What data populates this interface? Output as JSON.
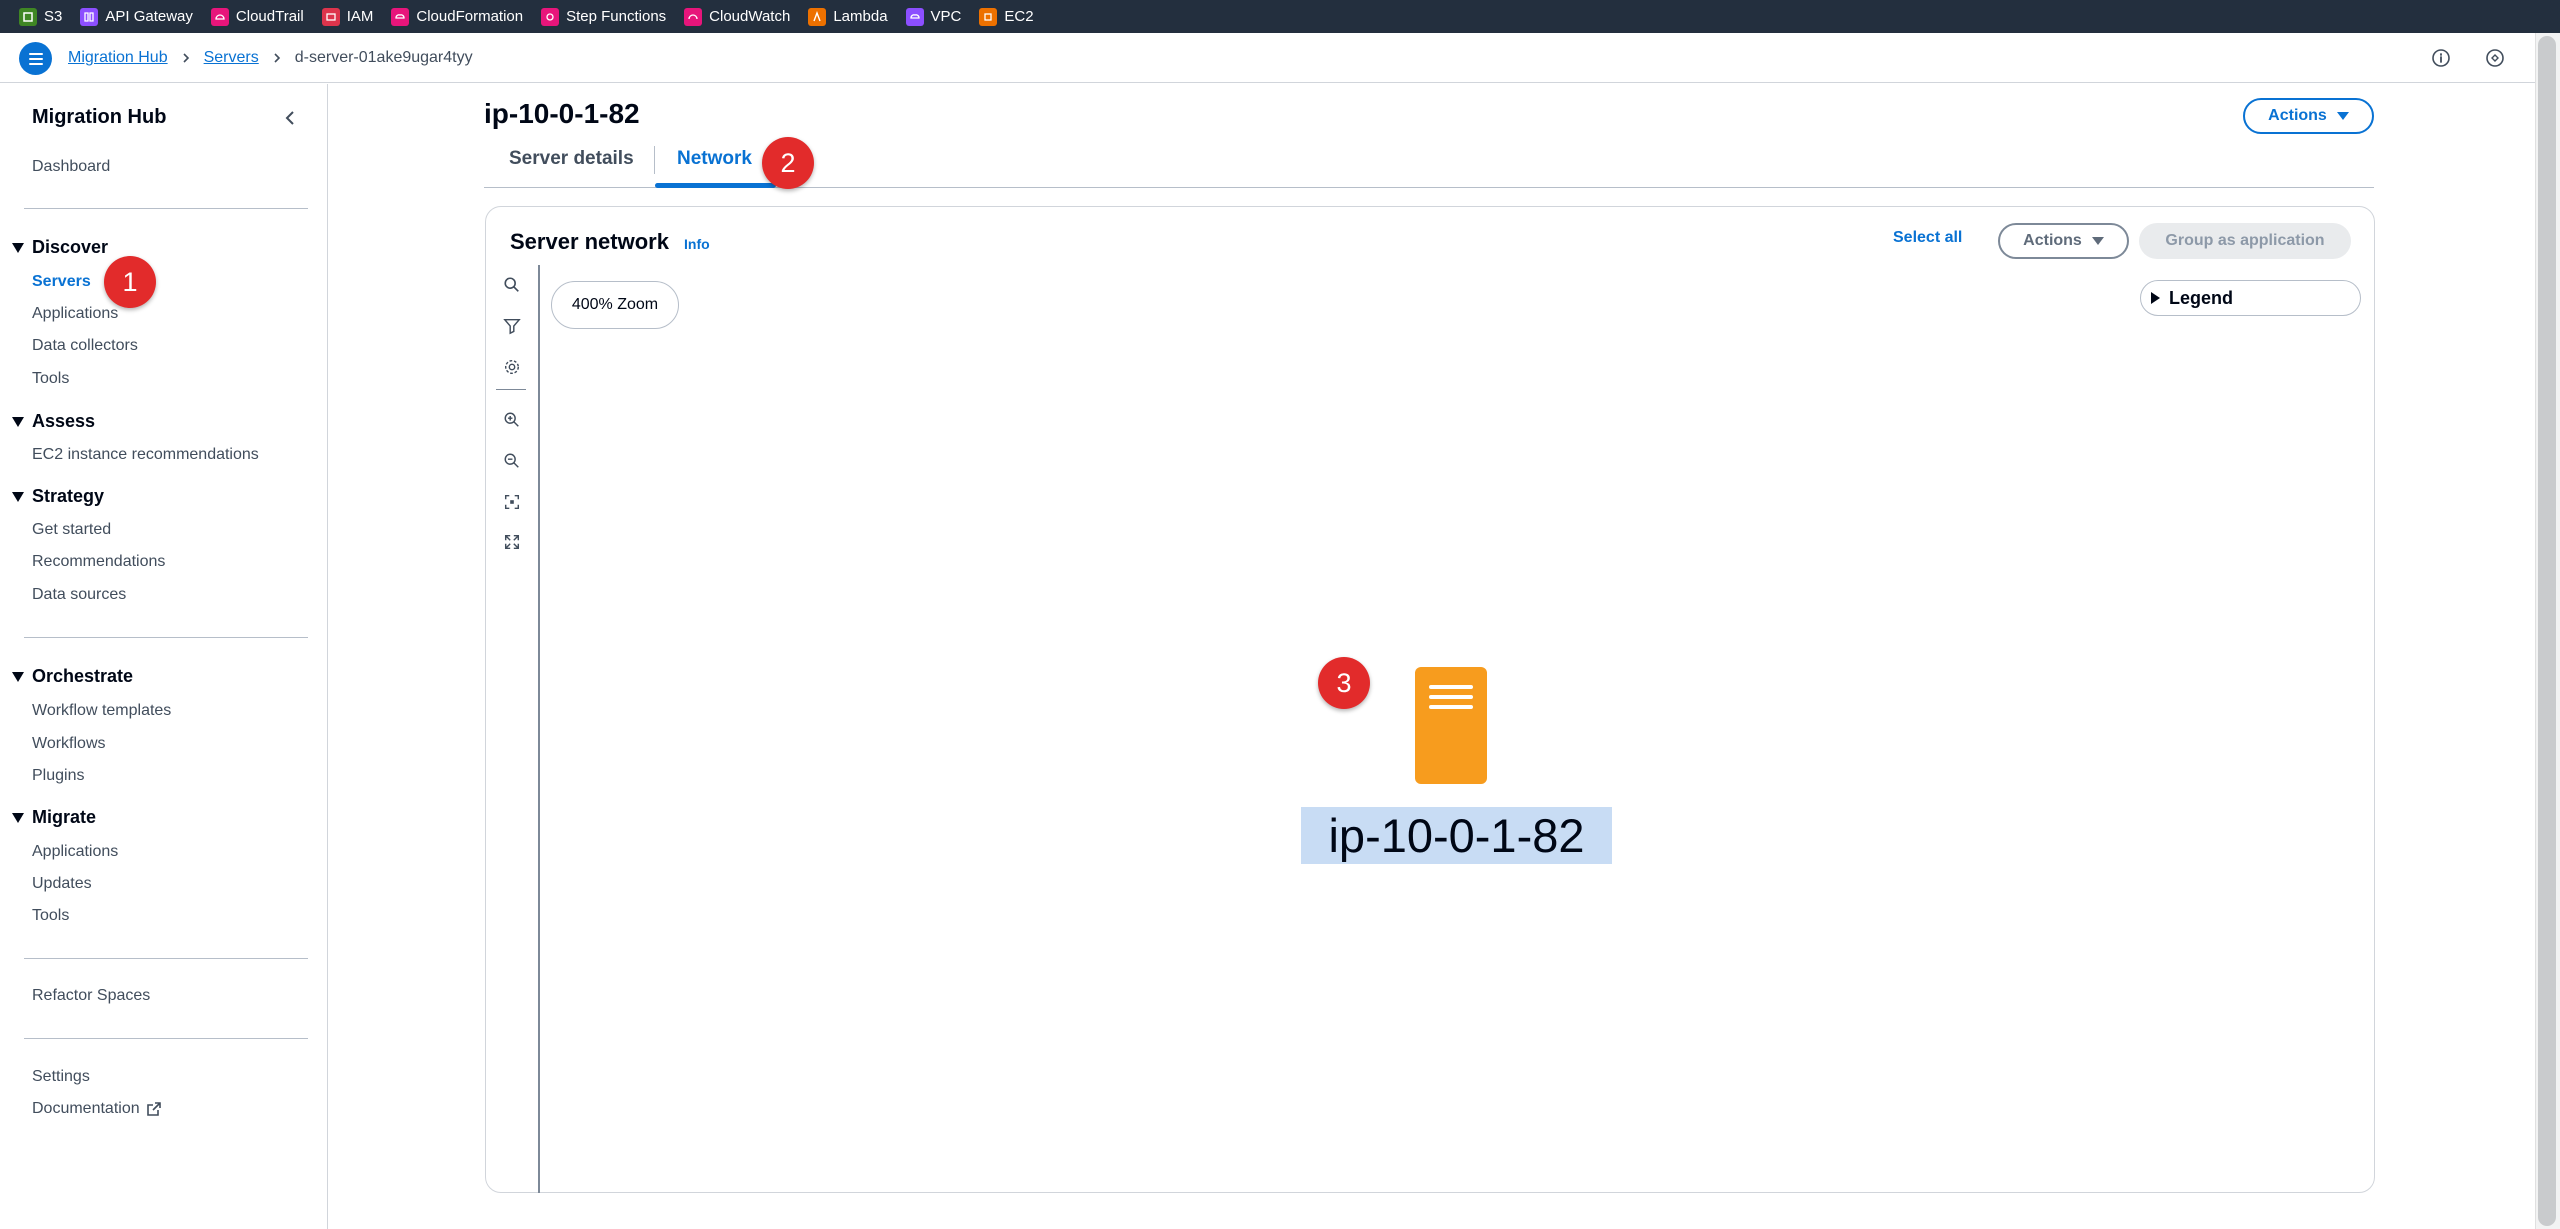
{
  "top_services": [
    {
      "label": "S3",
      "color": "#3f8624",
      "icon": "s3-icon"
    },
    {
      "label": "API Gateway",
      "color": "#8c4fff",
      "icon": "api-gateway-icon"
    },
    {
      "label": "CloudTrail",
      "color": "#e7157b",
      "icon": "cloudtrail-icon"
    },
    {
      "label": "IAM",
      "color": "#dd344c",
      "icon": "iam-icon"
    },
    {
      "label": "CloudFormation",
      "color": "#e7157b",
      "icon": "cloudformation-icon"
    },
    {
      "label": "Step Functions",
      "color": "#e7157b",
      "icon": "step-functions-icon"
    },
    {
      "label": "CloudWatch",
      "color": "#e7157b",
      "icon": "cloudwatch-icon"
    },
    {
      "label": "Lambda",
      "color": "#ed7100",
      "icon": "lambda-icon"
    },
    {
      "label": "VPC",
      "color": "#8c4fff",
      "icon": "vpc-icon"
    },
    {
      "label": "EC2",
      "color": "#ed7100",
      "icon": "ec2-icon"
    }
  ],
  "breadcrumb": {
    "root": "Migration Hub",
    "parent": "Servers",
    "current": "d-server-01ake9ugar4tyy"
  },
  "sidebar": {
    "title": "Migration Hub",
    "dashboard": "Dashboard",
    "discover": {
      "label": "Discover",
      "items": [
        "Servers",
        "Applications",
        "Data collectors",
        "Tools"
      ]
    },
    "assess": {
      "label": "Assess",
      "items": [
        "EC2 instance recommendations"
      ]
    },
    "strategy": {
      "label": "Strategy",
      "items": [
        "Get started",
        "Recommendations",
        "Data sources"
      ]
    },
    "orchestrate": {
      "label": "Orchestrate",
      "items": [
        "Workflow templates",
        "Workflows",
        "Plugins"
      ]
    },
    "migrate": {
      "label": "Migrate",
      "items": [
        "Applications",
        "Updates",
        "Tools"
      ]
    },
    "refactor": "Refactor Spaces",
    "settings": "Settings",
    "documentation": "Documentation"
  },
  "main": {
    "title": "ip-10-0-1-82",
    "actions_label": "Actions",
    "tabs": [
      {
        "label": "Server details",
        "active": false
      },
      {
        "label": "Network",
        "active": true
      }
    ],
    "network": {
      "title": "Server network",
      "info": "Info",
      "select_all": "Select all",
      "actions": "Actions",
      "group_as_application": "Group as application",
      "zoom": "400% Zoom",
      "legend": "Legend",
      "node_label": "ip-10-0-1-82"
    }
  },
  "badges": [
    "1",
    "2",
    "3"
  ],
  "colors": {
    "accent": "#0972d3",
    "topbar": "#232f3e",
    "server_node": "#f79c1e",
    "badge": "#e22b2b"
  }
}
